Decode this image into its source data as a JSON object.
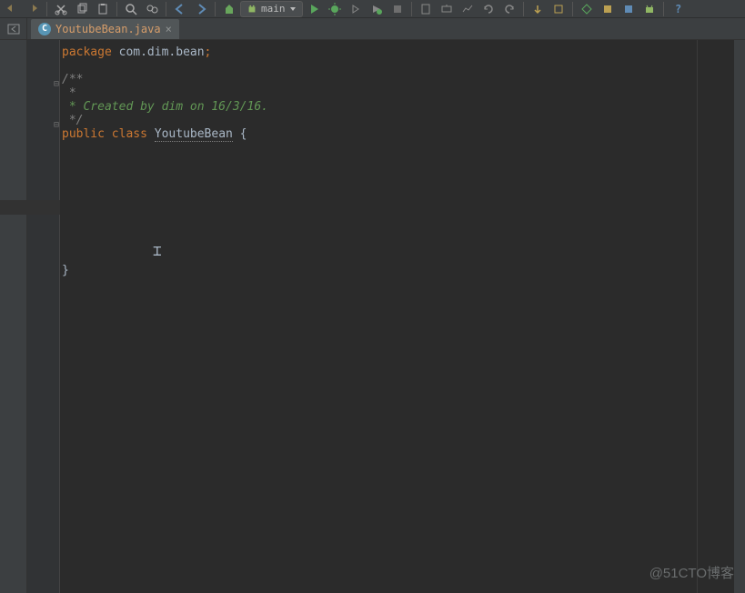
{
  "toolbar": {
    "run_config_label": "main"
  },
  "tab": {
    "icon_letter": "C",
    "label": "YoutubeBean.java"
  },
  "code": {
    "l1_kw": "package",
    "l1_pkg": " com.dim.bean",
    "l1_semi": ";",
    "l3": "/**",
    "l4": " *",
    "l5": " * Created by dim on 16/3/16.",
    "l6": " */",
    "l7_kw1": "public",
    "l7_kw2": " class ",
    "l7_name": "YoutubeBean",
    "l7_brace": " {",
    "l_end": "}"
  },
  "watermark": "@51CTO博客"
}
